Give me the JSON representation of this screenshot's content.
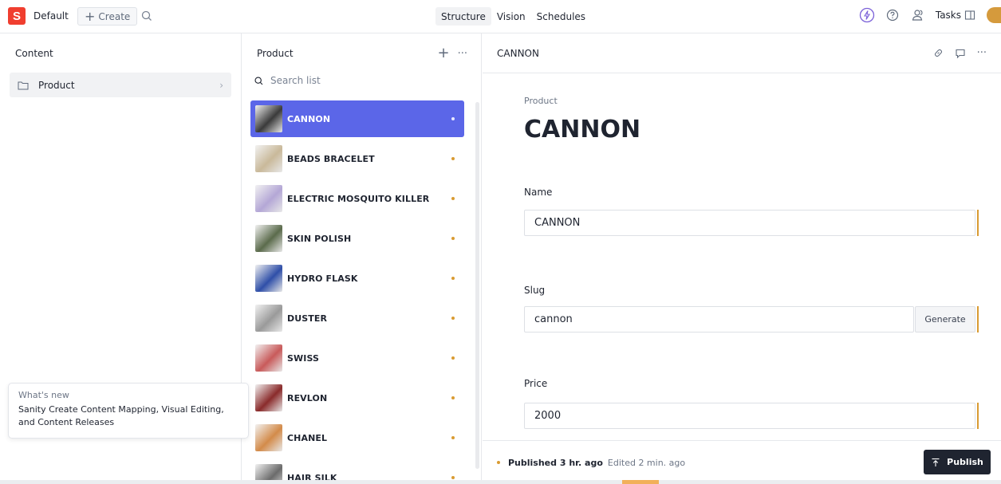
{
  "topbar": {
    "logo_letter": "S",
    "workspace": "Default",
    "create_label": "Create",
    "nav": [
      {
        "label": "Structure",
        "active": true
      },
      {
        "label": "Vision",
        "active": false
      },
      {
        "label": "Schedules",
        "active": false
      }
    ],
    "tasks_label": "Tasks"
  },
  "content_pane": {
    "title": "Content",
    "items": [
      {
        "label": "Product",
        "icon": "folder-icon"
      }
    ]
  },
  "whats_new": {
    "label": "What's new",
    "text": "Sanity Create Content Mapping, Visual Editing, and Content Releases"
  },
  "list_pane": {
    "title": "Product",
    "search_placeholder": "Search list",
    "items": [
      {
        "title": "CANNON",
        "selected": true,
        "thumb_color": "#3a3a3a"
      },
      {
        "title": "BEADS BRACELET",
        "selected": false,
        "thumb_color": "#c9b99a"
      },
      {
        "title": "ELECTRIC MOSQUITO KILLER",
        "selected": false,
        "thumb_color": "#b4a7d6"
      },
      {
        "title": "SKIN POLISH",
        "selected": false,
        "thumb_color": "#5b6b4c"
      },
      {
        "title": "HYDRO FLASK",
        "selected": false,
        "thumb_color": "#2f4fa8"
      },
      {
        "title": "DUSTER",
        "selected": false,
        "thumb_color": "#9a9a9a"
      },
      {
        "title": "SWISS",
        "selected": false,
        "thumb_color": "#c85a5a"
      },
      {
        "title": "REVLON",
        "selected": false,
        "thumb_color": "#8a2b2b"
      },
      {
        "title": "CHANEL",
        "selected": false,
        "thumb_color": "#d38b4a"
      },
      {
        "title": "HAIR SILK",
        "selected": false,
        "thumb_color": "#6b6b6b"
      }
    ]
  },
  "document": {
    "header_title": "CANNON",
    "type_label": "Product",
    "title": "CANNON",
    "fields": {
      "name_label": "Name",
      "name_value": "CANNON",
      "slug_label": "Slug",
      "slug_value": "cannon",
      "generate_label": "Generate",
      "price_label": "Price",
      "price_value": "2000"
    },
    "footer": {
      "published": "Published 3 hr. ago",
      "edited": "Edited 2 min. ago",
      "publish_label": "Publish"
    }
  },
  "colors": {
    "accent": "#5b66e8",
    "brand": "#f03e2f",
    "change": "#d99b32",
    "publish_bg": "#1f2430"
  }
}
